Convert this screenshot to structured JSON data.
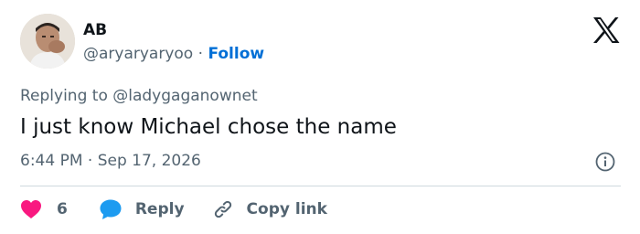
{
  "author": {
    "name": "AB",
    "handle": "@aryaryaryoo",
    "separator": "·",
    "follow_label": "Follow"
  },
  "brand_icon": "x-logo-icon",
  "reply_context": {
    "prefix": "Replying to ",
    "mention": "@ladygaganownet"
  },
  "tweet": {
    "text": "I just know Michael chose the name",
    "time": "6:44 PM",
    "separator": "·",
    "date": "Sep 17, 2026"
  },
  "actions": {
    "like_count": "6",
    "reply_label": "Reply",
    "copy_link_label": "Copy link"
  },
  "colors": {
    "like": "#f91880",
    "reply": "#1d9bf0",
    "follow": "#006fd6",
    "muted": "#536471",
    "text": "#0f1419"
  }
}
